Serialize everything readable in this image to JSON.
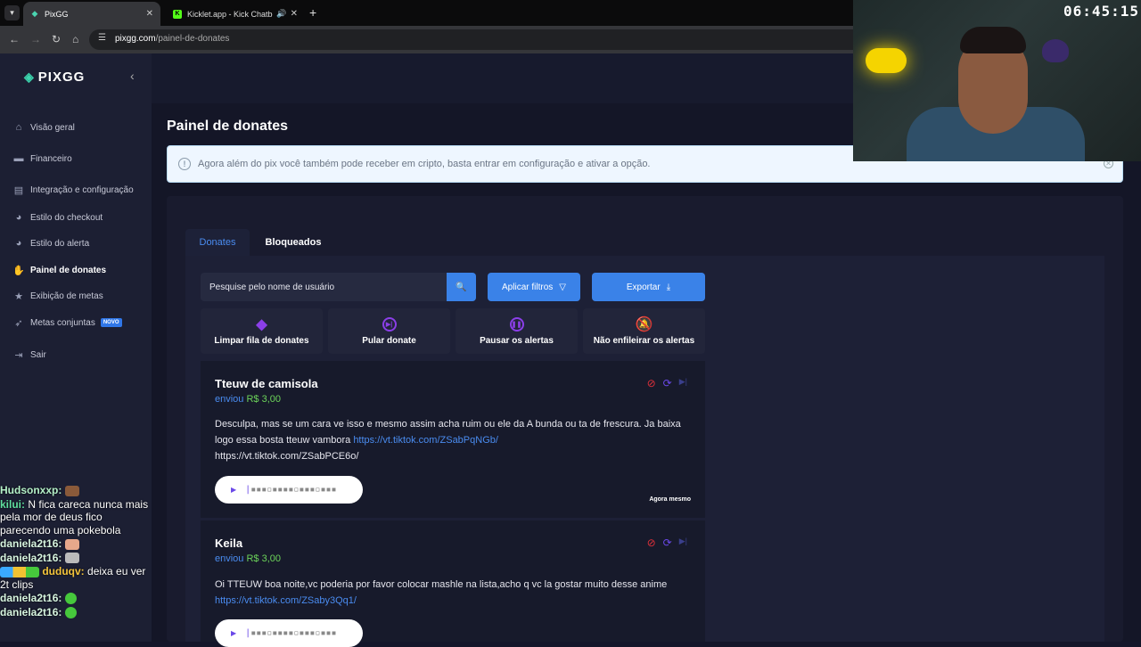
{
  "browser": {
    "tabs": [
      {
        "title": "PixGG",
        "active": true
      },
      {
        "title": "Kicklet.app - Kick Chatbot a",
        "active": false
      }
    ],
    "url_host": "pixgg.com",
    "url_path": "/painel-de-donates",
    "clock": "06:45:15"
  },
  "sidebar": {
    "logo": "PIXGG",
    "items": [
      {
        "label": "Visão geral",
        "icon": "home-icon"
      },
      {
        "label": "Financeiro",
        "icon": "wallet-icon"
      },
      {
        "label": "Integração e configuração",
        "icon": "document-icon"
      },
      {
        "label": "Estilo do checkout",
        "icon": "palette-icon"
      },
      {
        "label": "Estilo do alerta",
        "icon": "palette-icon"
      },
      {
        "label": "Painel de donates",
        "icon": "hand-coin-icon",
        "active": true
      },
      {
        "label": "Exibição de metas",
        "icon": "star-icon"
      },
      {
        "label": "Metas conjuntas",
        "icon": "rocket-icon",
        "badge": "NOVO"
      },
      {
        "label": "Sair",
        "icon": "logout-icon"
      }
    ]
  },
  "chat": [
    {
      "user": "Hudsonxxp:",
      "text": ""
    },
    {
      "user": "kilui:",
      "text": "N fica careca nunca mais pela mor de deus fico parecendo uma pokebola"
    },
    {
      "user": "daniela2t16:",
      "text": ""
    },
    {
      "user": "daniela2t16:",
      "text": ""
    },
    {
      "user": "duduqv:",
      "text": "deixa eu ver 2t clips"
    },
    {
      "user": "daniela2t16:",
      "text": ""
    },
    {
      "user": "daniela2t16:",
      "text": ""
    }
  ],
  "page": {
    "title": "Painel de donates",
    "alert": "Agora além do pix você também pode receber em cripto, basta entrar em configuração e ativar a opção.",
    "tabs": [
      "Donates",
      "Bloqueados"
    ],
    "search_placeholder": "Pesquise pelo nome de usuário",
    "apply_filters": "Aplicar filtros",
    "export": "Exportar",
    "actions": [
      {
        "label": "Limpar fila de donates",
        "icon": "eraser-icon"
      },
      {
        "label": "Pular donate",
        "icon": "skip-icon"
      },
      {
        "label": "Pausar os alertas",
        "icon": "pause-icon"
      },
      {
        "label": "Não enfileirar os alertas",
        "icon": "bell-off-icon"
      }
    ]
  },
  "donations": [
    {
      "name": "Tteuw de camisola",
      "sent_label": "enviou",
      "amount": "R$ 3,00",
      "message_a": "Desculpa, mas se um cara ve isso e mesmo assim acha ruim ou ele da A bunda ou ta de frescura. Ja baixa logo essa bosta tteuw vambora ",
      "link": "https://vt.tiktok.com/ZSabPqNGb/",
      "message_b": "https://vt.tiktok.com/ZSabPCE6o/",
      "time": "Agora mesmo"
    },
    {
      "name": "Keila",
      "sent_label": "enviou",
      "amount": "R$ 3,00",
      "message_a": "Oi TTEUW boa noite,vc poderia por favor colocar mashle na lista,acho q vc la gostar muito desse anime",
      "link": "https://vt.tiktok.com/ZSaby3Qq1/"
    }
  ]
}
